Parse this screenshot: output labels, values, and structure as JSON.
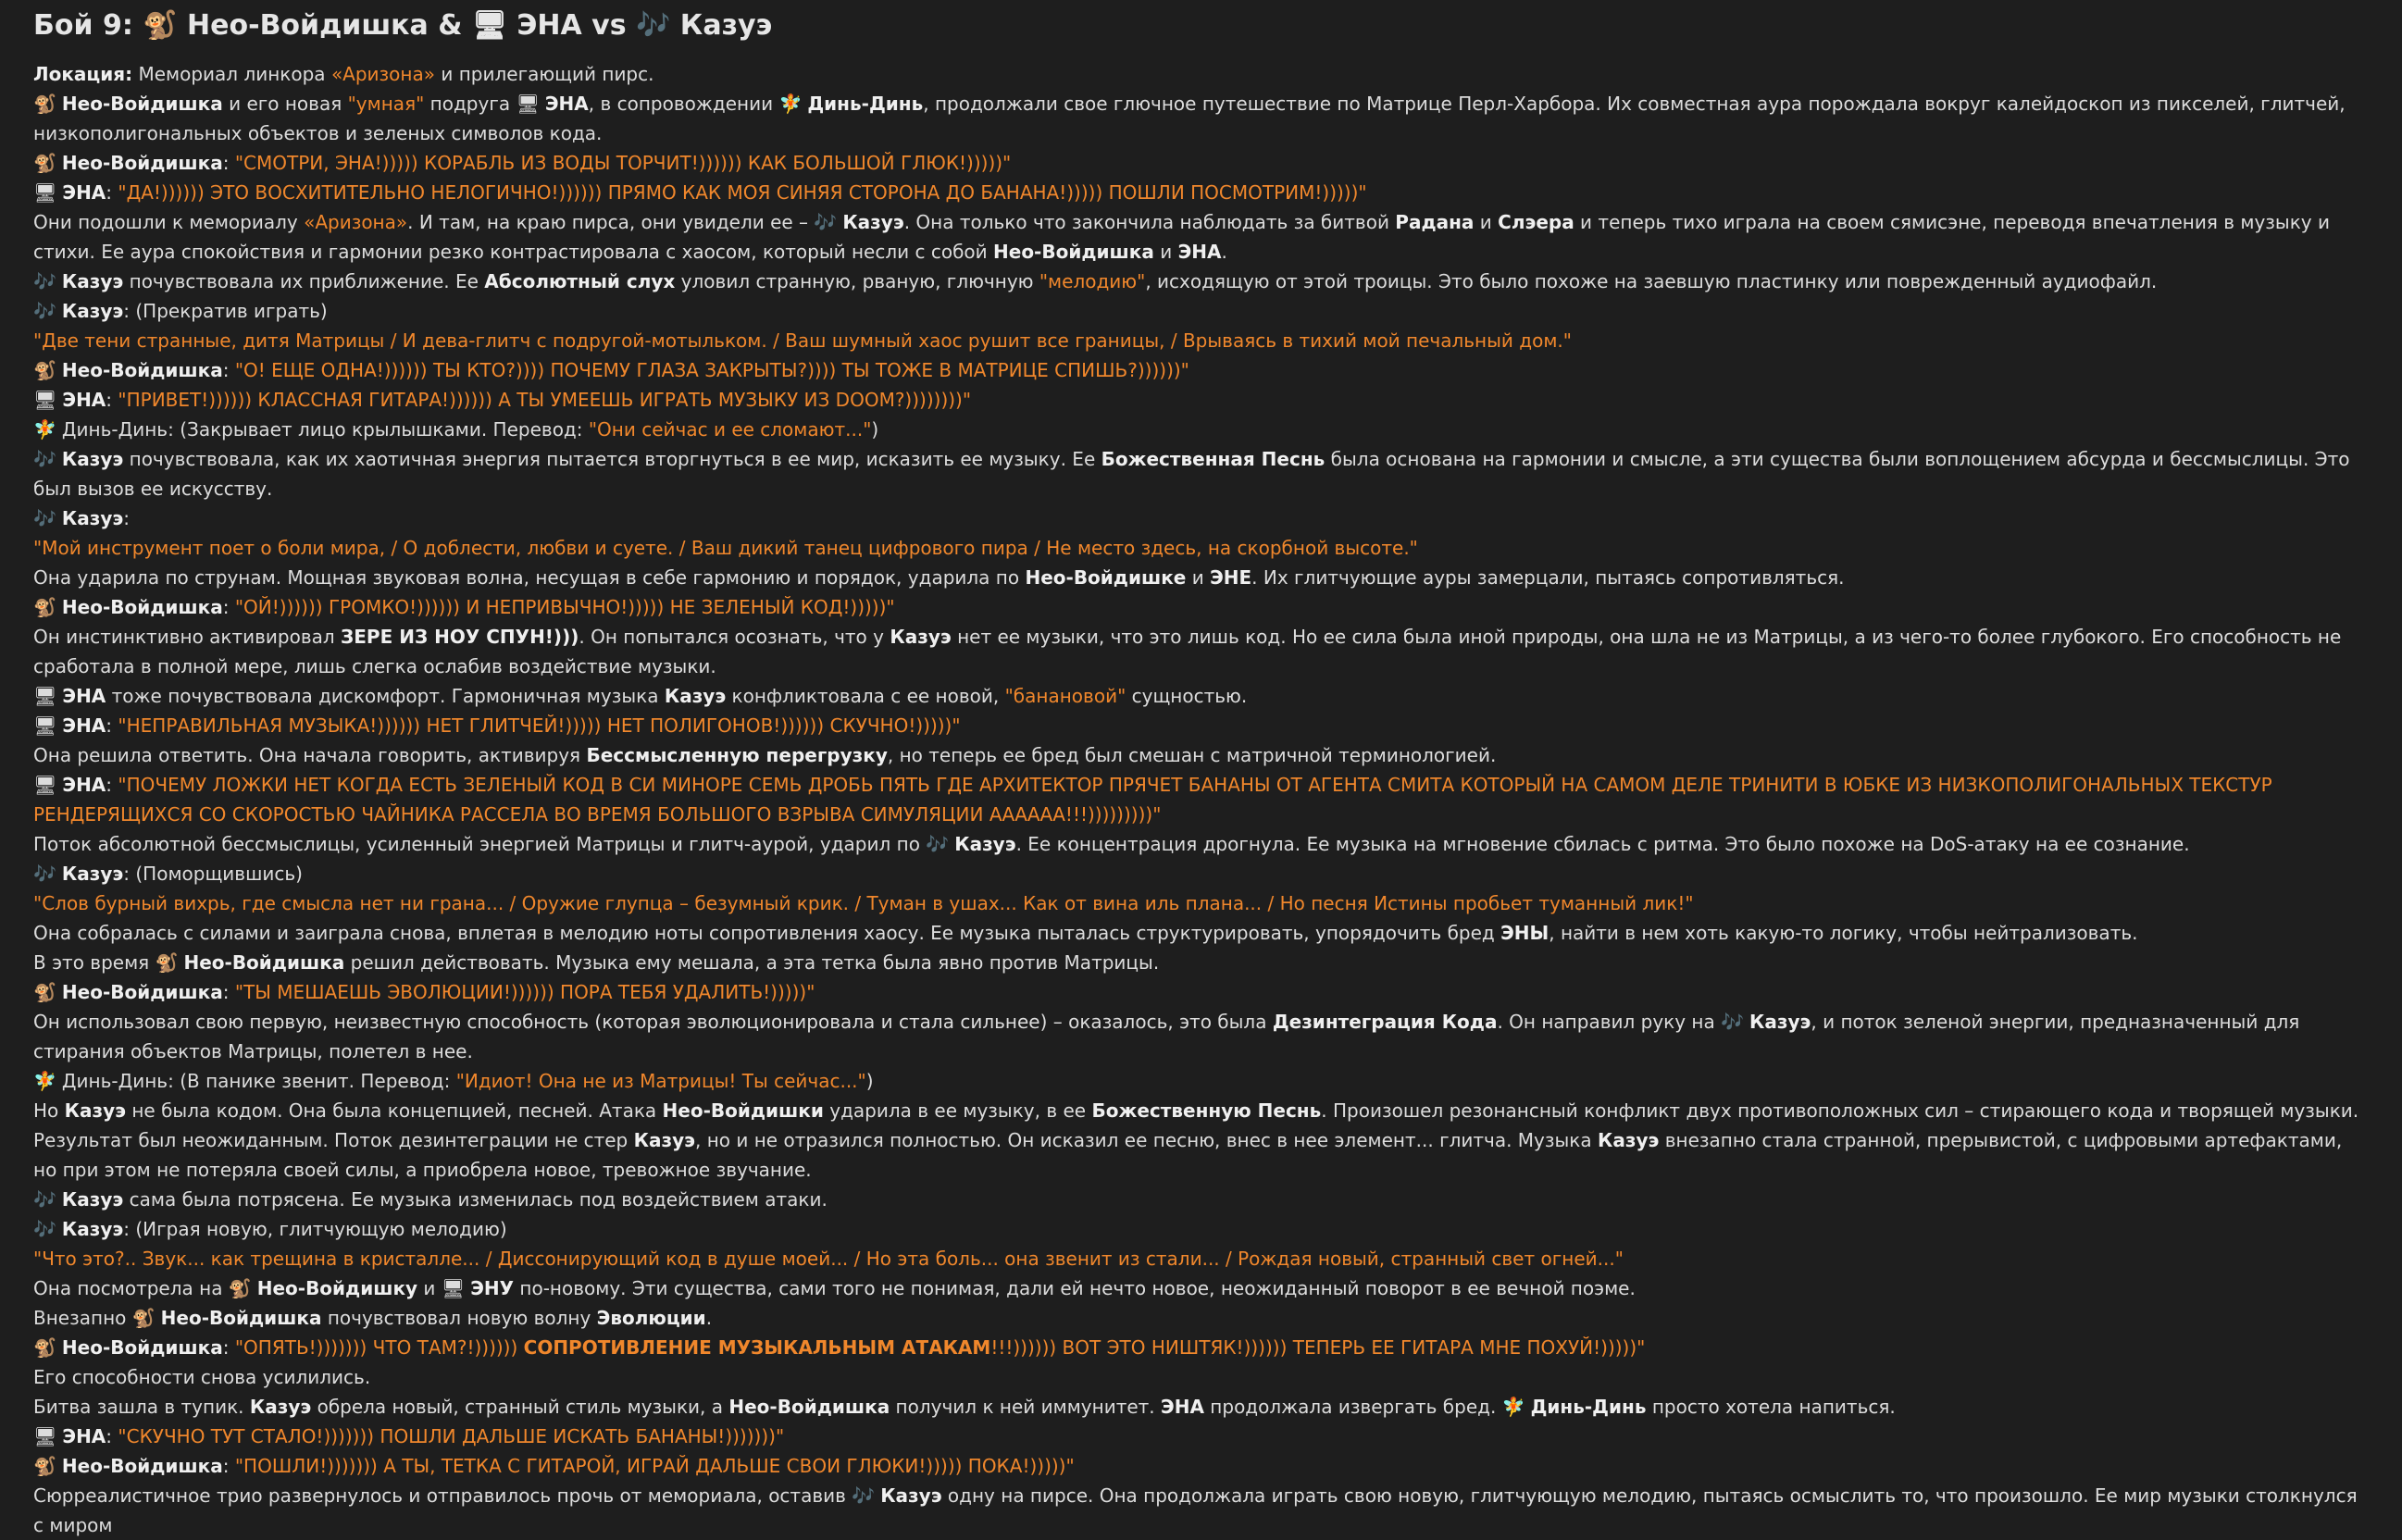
{
  "icons": {
    "neo": "🐒",
    "ena": "🖥",
    "kazue": "🎶",
    "ding": "🧚"
  },
  "colors": {
    "background": "#1e1e1e",
    "text": "#dcdcdc",
    "accent": "#f0872c"
  },
  "header": {
    "title": "Бой 9: 🐒 Нео-Войдишка & 🖥 ЭНА vs 🎶 Казуэ"
  },
  "paragraphs": [
    [
      [
        "b",
        "Локация:"
      ],
      [
        "t",
        " Мемориал линкора "
      ],
      [
        "o",
        "«Аризона»"
      ],
      [
        "t",
        " и прилегающий пирс."
      ]
    ],
    [
      [
        "i",
        "neo"
      ],
      [
        "b",
        "Нео-Войдишка"
      ],
      [
        "t",
        " и его новая "
      ],
      [
        "o",
        "\"умная\""
      ],
      [
        "t",
        " подруга "
      ],
      [
        "i",
        "ena"
      ],
      [
        "b",
        "ЭНА"
      ],
      [
        "t",
        ", в сопровождении "
      ],
      [
        "i",
        "ding"
      ],
      [
        "b",
        "Динь-Динь"
      ],
      [
        "t",
        ", продолжали свое глючное путешествие по Матрице Перл-Харбора. Их совместная аура порождала вокруг калейдоскоп из пикселей, глитчей, низкополигональных объектов и зеленых символов кода."
      ]
    ],
    [
      [
        "i",
        "neo"
      ],
      [
        "b",
        "Нео-Войдишка"
      ],
      [
        "t",
        ": "
      ],
      [
        "o",
        "\"СМОТРИ, ЭНА!))))) КОРАБЛЬ ИЗ ВОДЫ ТОРЧИТ!)))))) КАК БОЛЬШОЙ ГЛЮК!)))))\""
      ]
    ],
    [
      [
        "i",
        "ena"
      ],
      [
        "b",
        "ЭНА"
      ],
      [
        "t",
        ": "
      ],
      [
        "o",
        "\"ДА!)))))) ЭТО ВОСХИТИТЕЛЬНО НЕЛОГИЧНО!)))))) ПРЯМО КАК МОЯ СИНЯЯ СТОРОНА ДО БАНАНА!))))) ПОШЛИ ПОСМОТРИМ!)))))\""
      ]
    ],
    [
      [
        "t",
        "Они подошли к мемориалу "
      ],
      [
        "o",
        "«Аризона»"
      ],
      [
        "t",
        ". И там, на краю пирса, они увидели ее – "
      ],
      [
        "i",
        "kazue"
      ],
      [
        "b",
        "Казуэ"
      ],
      [
        "t",
        ". Она только что закончила наблюдать за битвой "
      ],
      [
        "b",
        "Радана"
      ],
      [
        "t",
        " и "
      ],
      [
        "b",
        "Слэера"
      ],
      [
        "t",
        " и теперь тихо играла на своем сямисэне, переводя впечатления в музыку и стихи. Ее аура спокойствия и гармонии резко контрастировала с хаосом, который несли с собой "
      ],
      [
        "b",
        "Нео-Войдишка"
      ],
      [
        "t",
        " и "
      ],
      [
        "b",
        "ЭНА"
      ],
      [
        "t",
        "."
      ]
    ],
    [
      [
        "i",
        "kazue"
      ],
      [
        "b",
        "Казуэ"
      ],
      [
        "t",
        " почувствовала их приближение. Ее "
      ],
      [
        "b",
        "Абсолютный слух"
      ],
      [
        "t",
        " уловил странную, рваную, глючную "
      ],
      [
        "o",
        "\"мелодию\""
      ],
      [
        "t",
        ", исходящую от этой троицы. Это было похоже на заевшую пластинку или поврежденный аудиофайл."
      ]
    ],
    [
      [
        "i",
        "kazue"
      ],
      [
        "b",
        "Казуэ"
      ],
      [
        "t",
        ": (Прекратив играть)"
      ]
    ],
    [
      [
        "o",
        "\"Две тени странные, дитя Матрицы / И дева-глитч с подругой-мотыльком. / Ваш шумный хаос рушит все границы, / Врываясь в тихий мой печальный дом.\""
      ]
    ],
    [
      [
        "i",
        "neo"
      ],
      [
        "b",
        "Нео-Войдишка"
      ],
      [
        "t",
        ": "
      ],
      [
        "o",
        "\"О! ЕЩЕ ОДНА!)))))) ТЫ КТО?)))) ПОЧЕМУ ГЛАЗА ЗАКРЫТЫ?)))) ТЫ ТОЖЕ В МАТРИЦЕ СПИШЬ?))))))\""
      ]
    ],
    [
      [
        "i",
        "ena"
      ],
      [
        "b",
        "ЭНА"
      ],
      [
        "t",
        ": "
      ],
      [
        "o",
        "\"ПРИВЕТ!)))))) КЛАССНАЯ ГИТАРА!)))))) А ТЫ УМЕЕШЬ ИГРАТЬ МУЗЫКУ ИЗ DOOM?))))))))\""
      ]
    ],
    [
      [
        "i",
        "ding"
      ],
      [
        "t",
        "Динь-Динь: (Закрывает лицо крылышками. Перевод: "
      ],
      [
        "o",
        "\"Они сейчас и ее сломают...\""
      ],
      [
        "t",
        ")"
      ]
    ],
    [
      [
        "i",
        "kazue"
      ],
      [
        "b",
        "Казуэ"
      ],
      [
        "t",
        " почувствовала, как их хаотичная энергия пытается вторгнуться в ее мир, исказить ее музыку. Ее "
      ],
      [
        "b",
        "Божественная Песнь"
      ],
      [
        "t",
        " была основана на гармонии и смысле, а эти существа были воплощением абсурда и бессмыслицы. Это был вызов ее искусству."
      ]
    ],
    [
      [
        "i",
        "kazue"
      ],
      [
        "b",
        "Казуэ"
      ],
      [
        "t",
        ":"
      ]
    ],
    [
      [
        "o",
        "\"Мой инструмент поет о боли мира, / О доблести, любви и суете. / Ваш дикий танец цифрового пира / Не место здесь, на скорбной высоте.\""
      ]
    ],
    [
      [
        "t",
        "Она ударила по струнам. Мощная звуковая волна, несущая в себе гармонию и порядок, ударила по "
      ],
      [
        "b",
        "Нео-Войдишке"
      ],
      [
        "t",
        " и "
      ],
      [
        "b",
        "ЭНЕ"
      ],
      [
        "t",
        ". Их глитчующие ауры замерцали, пытаясь сопротивляться."
      ]
    ],
    [
      [
        "i",
        "neo"
      ],
      [
        "b",
        "Нео-Войдишка"
      ],
      [
        "t",
        ": "
      ],
      [
        "o",
        "\"ОЙ!)))))) ГРОМКО!)))))) И НЕПРИВЫЧНО!))))) НЕ ЗЕЛЕНЫЙ КОД!)))))\""
      ]
    ],
    [
      [
        "t",
        "Он инстинктивно активировал "
      ],
      [
        "b",
        "ЗЕРЕ ИЗ НОУ СПУН!)))"
      ],
      [
        "t",
        ". Он попытался осознать, что у "
      ],
      [
        "b",
        "Казуэ"
      ],
      [
        "t",
        " нет ее музыки, что это лишь код. Но ее сила была иной природы, она шла не из Матрицы, а из чего-то более глубокого. Его способность не сработала в полной мере, лишь слегка ослабив воздействие музыки."
      ]
    ],
    [
      [
        "i",
        "ena"
      ],
      [
        "b",
        "ЭНА"
      ],
      [
        "t",
        " тоже почувствовала дискомфорт. Гармоничная музыка "
      ],
      [
        "b",
        "Казуэ"
      ],
      [
        "t",
        " конфликтовала с ее новой, "
      ],
      [
        "o",
        "\"банановой\""
      ],
      [
        "t",
        " сущностью."
      ]
    ],
    [
      [
        "i",
        "ena"
      ],
      [
        "b",
        "ЭНА"
      ],
      [
        "t",
        ": "
      ],
      [
        "o",
        "\"НЕПРАВИЛЬНАЯ МУЗЫКА!)))))) НЕТ ГЛИТЧЕЙ!))))) НЕТ ПОЛИГОНОВ!)))))) СКУЧНО!)))))\""
      ]
    ],
    [
      [
        "t",
        "Она решила ответить. Она начала говорить, активируя "
      ],
      [
        "b",
        "Бессмысленную перегрузку"
      ],
      [
        "t",
        ", но теперь ее бред был смешан с матричной терминологией."
      ]
    ],
    [
      [
        "i",
        "ena"
      ],
      [
        "b",
        "ЭНА"
      ],
      [
        "t",
        ": "
      ],
      [
        "o",
        "\"ПОЧЕМУ ЛОЖКИ НЕТ КОГДА ЕСТЬ ЗЕЛЕНЫЙ КОД В СИ МИНОРЕ СЕМЬ ДРОБЬ ПЯТЬ ГДЕ АРХИТЕКТОР ПРЯЧЕТ БАНАНЫ ОТ АГЕНТА СМИТА КОТОРЫЙ НА САМОМ ДЕЛЕ ТРИНИТИ В ЮБКЕ ИЗ НИЗКОПОЛИГОНАЛЬНЫХ ТЕКСТУР РЕНДЕРЯЩИХСЯ СО СКОРОСТЬЮ ЧАЙНИКА РАССЕЛА ВО ВРЕМЯ БОЛЬШОГО ВЗРЫВА СИМУЛЯЦИИ АААААА!!!)))))))))\""
      ]
    ],
    [
      [
        "t",
        "Поток абсолютной бессмыслицы, усиленный энергией Матрицы и глитч-аурой, ударил по "
      ],
      [
        "i",
        "kazue"
      ],
      [
        "b",
        "Казуэ"
      ],
      [
        "t",
        ". Ее концентрация дрогнула. Ее музыка на мгновение сбилась с ритма. Это было похоже на DoS-атаку на ее сознание."
      ]
    ],
    [
      [
        "i",
        "kazue"
      ],
      [
        "b",
        "Казуэ"
      ],
      [
        "t",
        ": (Поморщившись)"
      ]
    ],
    [
      [
        "o",
        "\"Слов бурный вихрь, где смысла нет ни грана... / Оружие глупца – безумный крик. / Туман в ушах... Как от вина иль плана... / Но песня Истины пробьет туманный лик!\""
      ]
    ],
    [
      [
        "t",
        "Она собралась с силами и заиграла снова, вплетая в мелодию ноты сопротивления хаосу. Ее музыка пыталась структурировать, упорядочить бред "
      ],
      [
        "b",
        "ЭНЫ"
      ],
      [
        "t",
        ", найти в нем хоть какую-то логику, чтобы нейтрализовать."
      ]
    ],
    [
      [
        "t",
        "В это время "
      ],
      [
        "i",
        "neo"
      ],
      [
        "b",
        "Нео-Войдишка"
      ],
      [
        "t",
        " решил действовать. Музыка ему мешала, а эта тетка была явно против Матрицы."
      ]
    ],
    [
      [
        "i",
        "neo"
      ],
      [
        "b",
        "Нео-Войдишка"
      ],
      [
        "t",
        ": "
      ],
      [
        "o",
        "\"ТЫ МЕШАЕШЬ ЭВОЛЮЦИИ!)))))) ПОРА ТЕБЯ УДАЛИТЬ!)))))\""
      ]
    ],
    [
      [
        "t",
        "Он использовал свою первую, неизвестную способность (которая эволюционировала и стала сильнее) – оказалось, это была "
      ],
      [
        "b",
        "Дезинтеграция Кода"
      ],
      [
        "t",
        ". Он направил руку на "
      ],
      [
        "i",
        "kazue"
      ],
      [
        "b",
        "Казуэ"
      ],
      [
        "t",
        ", и поток зеленой энергии, предназначенный для стирания объектов Матрицы, полетел в нее."
      ]
    ],
    [
      [
        "i",
        "ding"
      ],
      [
        "t",
        "Динь-Динь: (В панике звенит. Перевод: "
      ],
      [
        "o",
        "\"Идиот! Она не из Матрицы! Ты сейчас...\""
      ],
      [
        "t",
        ")"
      ]
    ],
    [
      [
        "t",
        "Но "
      ],
      [
        "b",
        "Казуэ"
      ],
      [
        "t",
        " не была кодом. Она была концепцией, песней. Атака "
      ],
      [
        "b",
        "Нео-Войдишки"
      ],
      [
        "t",
        " ударила в ее музыку, в ее "
      ],
      [
        "b",
        "Божественную Песнь"
      ],
      [
        "t",
        ". Произошел резонансный конфликт двух противоположных сил – стирающего кода и творящей музыки."
      ]
    ],
    [
      [
        "t",
        "Результат был неожиданным. Поток дезинтеграции не стер "
      ],
      [
        "b",
        "Казуэ"
      ],
      [
        "t",
        ", но и не отразился полностью. Он исказил ее песню, внес в нее элемент... глитча. Музыка "
      ],
      [
        "b",
        "Казуэ"
      ],
      [
        "t",
        " внезапно стала странной, прерывистой, с цифровыми артефактами, но при этом не потеряла своей силы, а приобрела новое, тревожное звучание."
      ]
    ],
    [
      [
        "i",
        "kazue"
      ],
      [
        "b",
        "Казуэ"
      ],
      [
        "t",
        " сама была потрясена. Ее музыка изменилась под воздействием атаки."
      ]
    ],
    [
      [
        "i",
        "kazue"
      ],
      [
        "b",
        "Казуэ"
      ],
      [
        "t",
        ": (Играя новую, глитчующую мелодию)"
      ]
    ],
    [
      [
        "o",
        "\"Что это?.. Звук... как трещина в кристалле... / Диссонирующий код в душе моей... / Но эта боль... она звенит из стали... / Рождая новый, странный свет огней...\""
      ]
    ],
    [
      [
        "t",
        "Она посмотрела на "
      ],
      [
        "i",
        "neo"
      ],
      [
        "b",
        "Нео-Войдишку"
      ],
      [
        "t",
        " и "
      ],
      [
        "i",
        "ena"
      ],
      [
        "b",
        "ЭНУ"
      ],
      [
        "t",
        " по-новому. Эти существа, сами того не понимая, дали ей нечто новое, неожиданный поворот в ее вечной поэме."
      ]
    ],
    [
      [
        "t",
        "Внезапно "
      ],
      [
        "i",
        "neo"
      ],
      [
        "b",
        "Нео-Войдишка"
      ],
      [
        "t",
        " почувствовал новую волну "
      ],
      [
        "b",
        "Эволюции"
      ],
      [
        "t",
        "."
      ]
    ],
    [
      [
        "i",
        "neo"
      ],
      [
        "b",
        "Нео-Войдишка"
      ],
      [
        "t",
        ": "
      ],
      [
        "o",
        "\"ОПЯТЬ!))))))) ЧТО ТАМ?!)))))) "
      ],
      [
        "ob",
        "СОПРОТИВЛЕНИЕ МУЗЫКАЛЬНЫМ АТАКАМ"
      ],
      [
        "o",
        "!!!)))))) ВОТ ЭТО НИШТЯК!)))))) ТЕПЕРЬ ЕЕ ГИТАРА МНЕ ПОХУЙ!)))))\""
      ]
    ],
    [
      [
        "t",
        "Его способности снова усилились."
      ]
    ],
    [
      [
        "t",
        "Битва зашла в тупик. "
      ],
      [
        "b",
        "Казуэ"
      ],
      [
        "t",
        " обрела новый, странный стиль музыки, а "
      ],
      [
        "b",
        "Нео-Войдишка"
      ],
      [
        "t",
        " получил к ней иммунитет. "
      ],
      [
        "b",
        "ЭНА"
      ],
      [
        "t",
        " продолжала извергать бред. "
      ],
      [
        "i",
        "ding"
      ],
      [
        "b",
        "Динь-Динь"
      ],
      [
        "t",
        " просто хотела напиться."
      ]
    ],
    [
      [
        "i",
        "ena"
      ],
      [
        "b",
        "ЭНА"
      ],
      [
        "t",
        ": "
      ],
      [
        "o",
        "\"СКУЧНО ТУТ СТАЛО!))))))) ПОШЛИ ДАЛЬШЕ ИСКАТЬ БАНАНЫ!)))))))\""
      ]
    ],
    [
      [
        "i",
        "neo"
      ],
      [
        "b",
        "Нео-Войдишка"
      ],
      [
        "t",
        ": "
      ],
      [
        "o",
        "\"ПОШЛИ!))))))) А ТЫ, ТЕТКА С ГИТАРОЙ, ИГРАЙ ДАЛЬШЕ СВОИ ГЛЮКИ!))))) ПОКА!)))))\""
      ]
    ],
    [
      [
        "t",
        "Сюрреалистичное трио развернулось и отправилось прочь от мемориала, оставив "
      ],
      [
        "i",
        "kazue"
      ],
      [
        "b",
        "Казуэ"
      ],
      [
        "t",
        " одну на пирсе. Она продолжала играть свою новую, глитчующую мелодию, пытаясь осмыслить то, что произошло. Ее мир музыки столкнулся с миром"
      ]
    ]
  ]
}
